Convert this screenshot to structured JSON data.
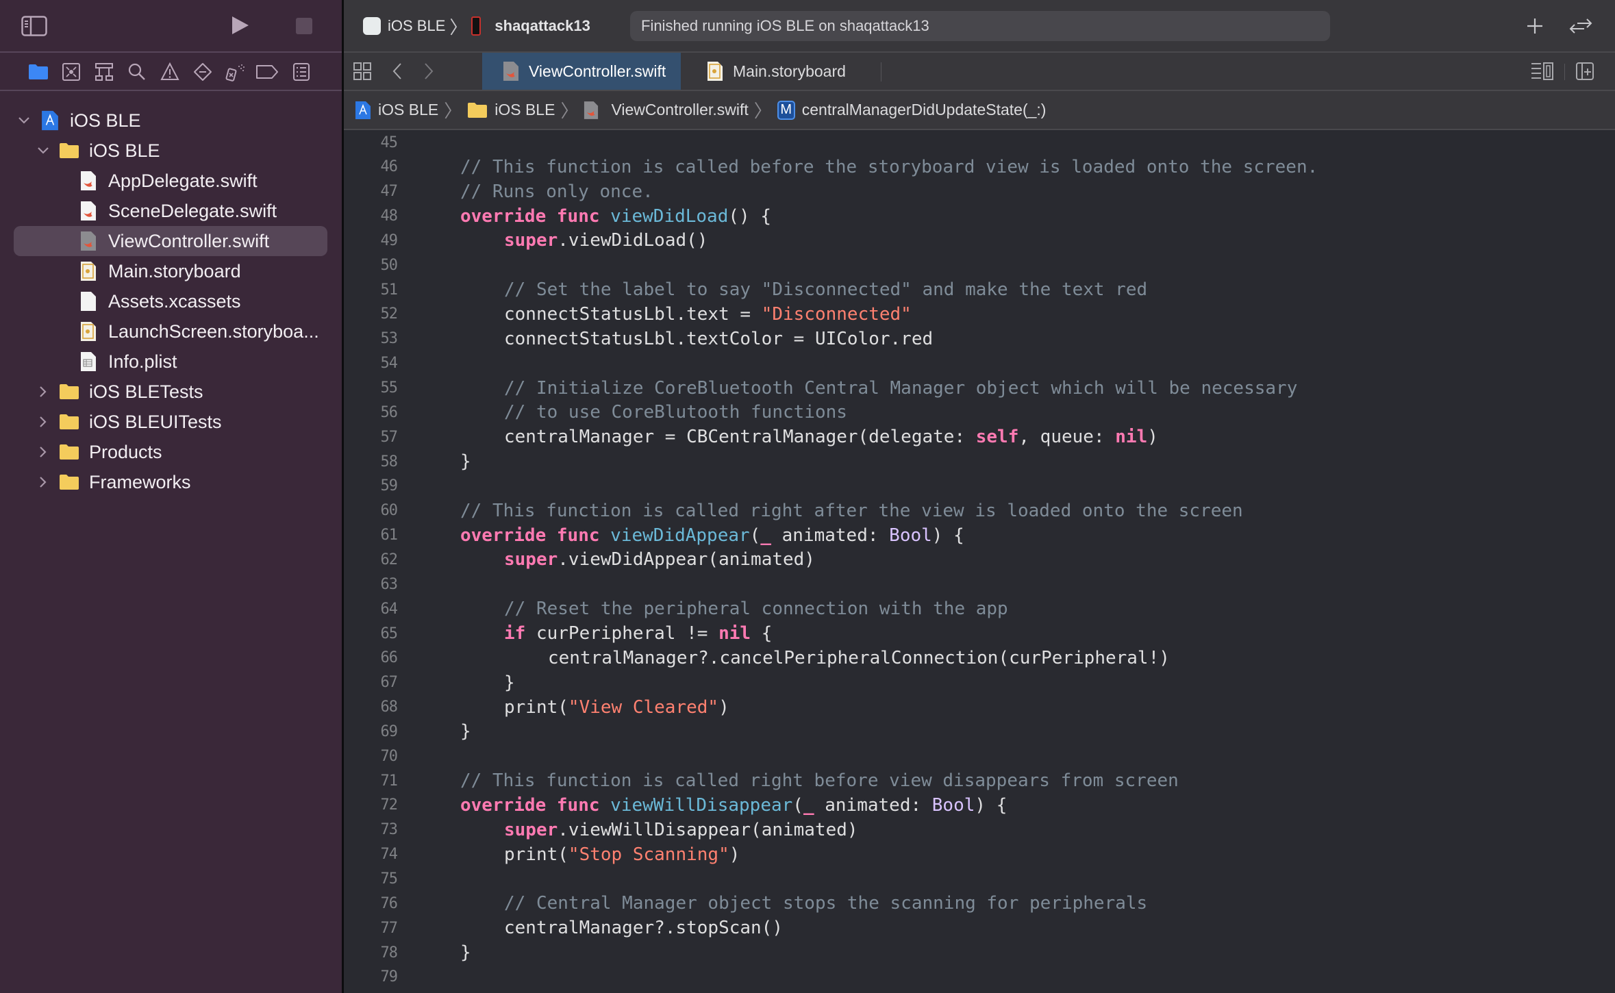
{
  "app": {
    "scheme_project": "iOS BLE",
    "scheme_device": "shaqattack13",
    "status_text": "Finished running iOS BLE on shaqattack13"
  },
  "sidebar": {
    "nav_icons": [
      "project-navigator-icon",
      "source-control-icon",
      "symbol-navigator-icon",
      "find-icon",
      "issue-navigator-icon",
      "test-navigator-icon",
      "debug-navigator-icon",
      "breakpoint-navigator-icon",
      "report-navigator-icon"
    ],
    "tree": [
      {
        "label": "iOS BLE",
        "level": 0,
        "kind": "project",
        "expanded": true
      },
      {
        "label": "iOS BLE",
        "level": 1,
        "kind": "folder",
        "expanded": true
      },
      {
        "label": "AppDelegate.swift",
        "level": 2,
        "kind": "swift"
      },
      {
        "label": "SceneDelegate.swift",
        "level": 2,
        "kind": "swift"
      },
      {
        "label": "ViewController.swift",
        "level": 2,
        "kind": "swift",
        "selected": true
      },
      {
        "label": "Main.storyboard",
        "level": 2,
        "kind": "storyboard"
      },
      {
        "label": "Assets.xcassets",
        "level": 2,
        "kind": "assets"
      },
      {
        "label": "LaunchScreen.storyboa...",
        "level": 2,
        "kind": "storyboard"
      },
      {
        "label": "Info.plist",
        "level": 2,
        "kind": "plist"
      },
      {
        "label": "iOS BLETests",
        "level": 1,
        "kind": "folder",
        "expanded": false
      },
      {
        "label": "iOS BLEUITests",
        "level": 1,
        "kind": "folder",
        "expanded": false
      },
      {
        "label": "Products",
        "level": 1,
        "kind": "folder",
        "expanded": false
      },
      {
        "label": "Frameworks",
        "level": 1,
        "kind": "folder",
        "expanded": false
      }
    ]
  },
  "tabs": [
    {
      "label": "ViewController.swift",
      "active": true,
      "kind": "swift"
    },
    {
      "label": "Main.storyboard",
      "active": false,
      "kind": "storyboard"
    }
  ],
  "breadcrumb": [
    {
      "label": "iOS BLE",
      "kind": "project"
    },
    {
      "label": "iOS BLE",
      "kind": "folder"
    },
    {
      "label": "ViewController.swift",
      "kind": "swift"
    },
    {
      "label": "centralManagerDidUpdateState(_:)",
      "kind": "method",
      "badge": "M"
    }
  ],
  "colors": {
    "keyword": "#ff7ab2",
    "function": "#6bb9d8",
    "string": "#ff8170",
    "type": "#d9c3ff",
    "comment": "#7f8c98",
    "plain": "#dfdfe0",
    "active_tab": "#34506f",
    "sidebar_bg": "#3a2839"
  },
  "code": [
    {
      "n": 45,
      "indent": 0,
      "tokens": []
    },
    {
      "n": 46,
      "indent": 1,
      "tokens": [
        [
          "c",
          "// This function is called before the storyboard view is loaded onto the screen."
        ]
      ]
    },
    {
      "n": 47,
      "indent": 1,
      "tokens": [
        [
          "c",
          "// Runs only once."
        ]
      ]
    },
    {
      "n": 48,
      "indent": 1,
      "tokens": [
        [
          "k",
          "override"
        ],
        [
          "p",
          " "
        ],
        [
          "k",
          "func"
        ],
        [
          "p",
          " "
        ],
        [
          "f",
          "viewDidLoad"
        ],
        [
          "p",
          "() {"
        ]
      ]
    },
    {
      "n": 49,
      "indent": 2,
      "tokens": [
        [
          "k",
          "super"
        ],
        [
          "p",
          ".viewDidLoad()"
        ]
      ]
    },
    {
      "n": 50,
      "indent": 0,
      "tokens": []
    },
    {
      "n": 51,
      "indent": 2,
      "tokens": [
        [
          "c",
          "// Set the label to say \"Disconnected\" and make the text red"
        ]
      ]
    },
    {
      "n": 52,
      "indent": 2,
      "tokens": [
        [
          "p",
          "connectStatusLbl.text = "
        ],
        [
          "s",
          "\"Disconnected\""
        ]
      ]
    },
    {
      "n": 53,
      "indent": 2,
      "tokens": [
        [
          "p",
          "connectStatusLbl.textColor = UIColor.red"
        ]
      ]
    },
    {
      "n": 54,
      "indent": 0,
      "tokens": []
    },
    {
      "n": 55,
      "indent": 2,
      "tokens": [
        [
          "c",
          "// Initialize CoreBluetooth Central Manager object which will be necessary"
        ]
      ]
    },
    {
      "n": 56,
      "indent": 2,
      "tokens": [
        [
          "c",
          "// to use CoreBlutooth functions"
        ]
      ]
    },
    {
      "n": 57,
      "indent": 2,
      "tokens": [
        [
          "p",
          "centralManager = CBCentralManager(delegate: "
        ],
        [
          "k",
          "self"
        ],
        [
          "p",
          ", queue: "
        ],
        [
          "k",
          "nil"
        ],
        [
          "p",
          ")"
        ]
      ]
    },
    {
      "n": 58,
      "indent": 1,
      "tokens": [
        [
          "p",
          "}"
        ]
      ]
    },
    {
      "n": 59,
      "indent": 0,
      "tokens": []
    },
    {
      "n": 60,
      "indent": 1,
      "tokens": [
        [
          "c",
          "// This function is called right after the view is loaded onto the screen"
        ]
      ]
    },
    {
      "n": 61,
      "indent": 1,
      "tokens": [
        [
          "k",
          "override"
        ],
        [
          "p",
          " "
        ],
        [
          "k",
          "func"
        ],
        [
          "p",
          " "
        ],
        [
          "f",
          "viewDidAppear"
        ],
        [
          "p",
          "("
        ],
        [
          "k",
          "_"
        ],
        [
          "p",
          " animated: "
        ],
        [
          "t",
          "Bool"
        ],
        [
          "p",
          ") {"
        ]
      ]
    },
    {
      "n": 62,
      "indent": 2,
      "tokens": [
        [
          "k",
          "super"
        ],
        [
          "p",
          ".viewDidAppear(animated)"
        ]
      ]
    },
    {
      "n": 63,
      "indent": 0,
      "tokens": []
    },
    {
      "n": 64,
      "indent": 2,
      "tokens": [
        [
          "c",
          "// Reset the peripheral connection with the app"
        ]
      ]
    },
    {
      "n": 65,
      "indent": 2,
      "tokens": [
        [
          "k",
          "if"
        ],
        [
          "p",
          " curPeripheral != "
        ],
        [
          "k",
          "nil"
        ],
        [
          "p",
          " {"
        ]
      ]
    },
    {
      "n": 66,
      "indent": 3,
      "tokens": [
        [
          "p",
          "centralManager?.cancelPeripheralConnection(curPeripheral!)"
        ]
      ]
    },
    {
      "n": 67,
      "indent": 2,
      "tokens": [
        [
          "p",
          "}"
        ]
      ]
    },
    {
      "n": 68,
      "indent": 2,
      "tokens": [
        [
          "p",
          "print("
        ],
        [
          "s",
          "\"View Cleared\""
        ],
        [
          "p",
          ")"
        ]
      ]
    },
    {
      "n": 69,
      "indent": 1,
      "tokens": [
        [
          "p",
          "}"
        ]
      ]
    },
    {
      "n": 70,
      "indent": 0,
      "tokens": []
    },
    {
      "n": 71,
      "indent": 1,
      "tokens": [
        [
          "c",
          "// This function is called right before view disappears from screen"
        ]
      ]
    },
    {
      "n": 72,
      "indent": 1,
      "tokens": [
        [
          "k",
          "override"
        ],
        [
          "p",
          " "
        ],
        [
          "k",
          "func"
        ],
        [
          "p",
          " "
        ],
        [
          "f",
          "viewWillDisappear"
        ],
        [
          "p",
          "("
        ],
        [
          "k",
          "_"
        ],
        [
          "p",
          " animated: "
        ],
        [
          "t",
          "Bool"
        ],
        [
          "p",
          ") {"
        ]
      ]
    },
    {
      "n": 73,
      "indent": 2,
      "tokens": [
        [
          "k",
          "super"
        ],
        [
          "p",
          ".viewWillDisappear(animated)"
        ]
      ]
    },
    {
      "n": 74,
      "indent": 2,
      "tokens": [
        [
          "p",
          "print("
        ],
        [
          "s",
          "\"Stop Scanning\""
        ],
        [
          "p",
          ")"
        ]
      ]
    },
    {
      "n": 75,
      "indent": 0,
      "tokens": []
    },
    {
      "n": 76,
      "indent": 2,
      "tokens": [
        [
          "c",
          "// Central Manager object stops the scanning for peripherals"
        ]
      ]
    },
    {
      "n": 77,
      "indent": 2,
      "tokens": [
        [
          "p",
          "centralManager?.stopScan()"
        ]
      ]
    },
    {
      "n": 78,
      "indent": 1,
      "tokens": [
        [
          "p",
          "}"
        ]
      ]
    },
    {
      "n": 79,
      "indent": 0,
      "tokens": []
    }
  ]
}
